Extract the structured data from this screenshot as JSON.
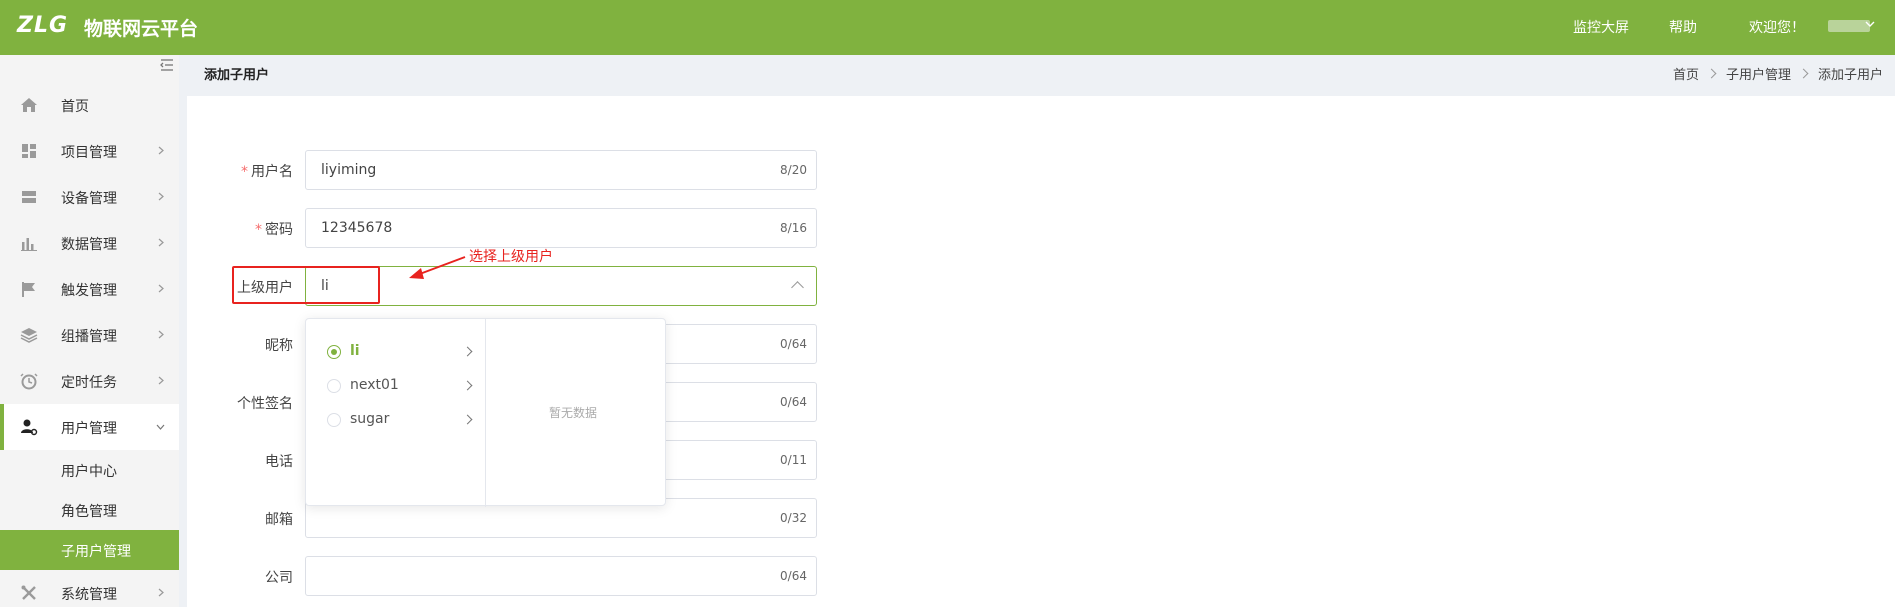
{
  "header": {
    "logo": "ZLG",
    "brand": "物联网云平台",
    "nav": {
      "monitor": "监控大屏",
      "help": "帮助",
      "welcome": "欢迎您！"
    },
    "accent_color": "#80b23f"
  },
  "sidebar": {
    "items": [
      {
        "label": "首页",
        "icon": "home-icon"
      },
      {
        "label": "项目管理",
        "icon": "grid-icon"
      },
      {
        "label": "设备管理",
        "icon": "server-icon"
      },
      {
        "label": "数据管理",
        "icon": "bar-chart-icon"
      },
      {
        "label": "触发管理",
        "icon": "flag-icon"
      },
      {
        "label": "组播管理",
        "icon": "layers-icon"
      },
      {
        "label": "定时任务",
        "icon": "clock-icon"
      },
      {
        "label": "用户管理",
        "icon": "user-gear-icon"
      },
      {
        "label": "系统管理",
        "icon": "tools-icon"
      }
    ],
    "user_subitems": [
      {
        "label": "用户中心"
      },
      {
        "label": "角色管理"
      },
      {
        "label": "子用户管理"
      }
    ]
  },
  "pagebar": {
    "title": "添加子用户",
    "breadcrumb": [
      "首页",
      "子用户管理",
      "添加子用户"
    ]
  },
  "form": {
    "username": {
      "label": "用户名",
      "value": "liyiming",
      "count": "8/20"
    },
    "password": {
      "label": "密码",
      "value": "12345678",
      "count": "8/16"
    },
    "parent": {
      "label": "上级用户",
      "value": "li"
    },
    "nickname": {
      "label": "昵称",
      "count": "0/64"
    },
    "signature": {
      "label": "个性签名",
      "count": "0/64"
    },
    "phone": {
      "label": "电话",
      "count": "0/11"
    },
    "email": {
      "label": "邮箱",
      "count": "0/32"
    },
    "company": {
      "label": "公司",
      "count": "0/64"
    }
  },
  "annotation": {
    "text": "选择上级用户",
    "color": "#e8231f"
  },
  "dropdown": {
    "options": [
      {
        "label": "li",
        "checked": true
      },
      {
        "label": "next01",
        "checked": false
      },
      {
        "label": "sugar",
        "checked": false
      }
    ],
    "empty_text": "暂无数据"
  }
}
